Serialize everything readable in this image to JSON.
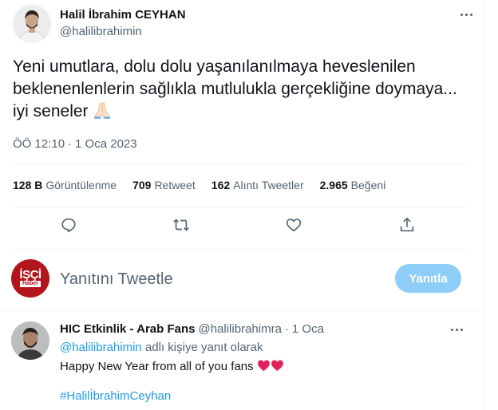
{
  "tweet": {
    "author_name": "Halil İbrahim CEYHAN",
    "author_handle": "@halilibrahimin",
    "text": "Yeni umutlara, dolu dolu yaşanılanılmaya heveslenilen beklenenlenlerin sağlıkla mutlulukla gerçekliğine doymaya... iyi seneler",
    "emoji_icon": "folded-hands-icon",
    "time": "ÖÖ 12:10",
    "date": "1 Oca 2023",
    "stats": [
      {
        "value": "128 B",
        "label": "Görüntülenme"
      },
      {
        "value": "709",
        "label": "Retweet"
      },
      {
        "value": "162",
        "label": "Alıntı Tweetler"
      },
      {
        "value": "2.965",
        "label": "Beğeni"
      }
    ],
    "actions": [
      "reply-icon",
      "retweet-icon",
      "like-icon",
      "share-icon"
    ]
  },
  "composer": {
    "avatar_text_line1": "İŞÇİ",
    "avatar_text_line2": "Haber",
    "placeholder": "Yanıtını Tweetle",
    "button_label": "Yanıtla"
  },
  "reply": {
    "author_name": "HIC Etkinlik - Arab Fans",
    "author_handle": "@halilibrahimra",
    "time": "1 Oca",
    "replying_mention": "@halilibrahimin",
    "replying_suffix": "adlı kişiye yanıt olarak",
    "text": "Happy New Year from all of you fans",
    "hashtag": "#HalilİbrahimCeyhan"
  },
  "colors": {
    "accent": "#1d9bf0",
    "muted": "#536471",
    "heart": "#e0245e",
    "button_disabled": "#8ecdf8",
    "composer_avatar": "#b2161c"
  }
}
